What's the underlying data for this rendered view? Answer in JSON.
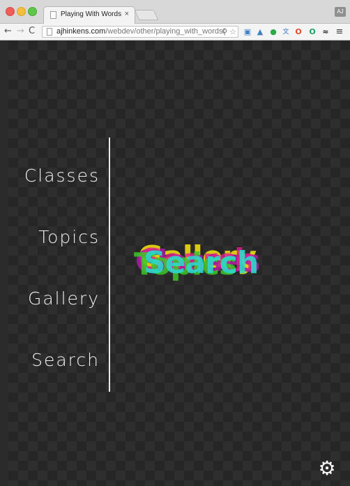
{
  "browser": {
    "tab_title": "Playing With Words",
    "tab_close": "×",
    "profile_initials": "AJ",
    "nav": {
      "back": "←",
      "forward": "→",
      "reload": "C"
    },
    "url_host": "ajhinkens.com",
    "url_path": "/webdev/other/playing_with_words/",
    "omnibox_icons": [
      "lightbulb-icon",
      "star-icon"
    ],
    "extension_icons": [
      "screenshot-icon",
      "extension-icon",
      "evernote-icon",
      "translate-icon",
      "adblock-icon",
      "opera-icon",
      "ext-icon",
      "menu-icon"
    ],
    "menu_glyph": "≡",
    "traffic_colors": {
      "close": "#ef5f5a",
      "minimize": "#f6bd3a",
      "zoom": "#5fc64a"
    }
  },
  "menu": {
    "items": [
      {
        "label": "Classes"
      },
      {
        "label": "Topics"
      },
      {
        "label": "Gallery"
      },
      {
        "label": "Search"
      }
    ]
  },
  "words": [
    "Gallery",
    "Classes",
    "Search",
    "Topics",
    "Search"
  ],
  "settings": {
    "icon": "gear-icon",
    "glyph": "⚙"
  }
}
